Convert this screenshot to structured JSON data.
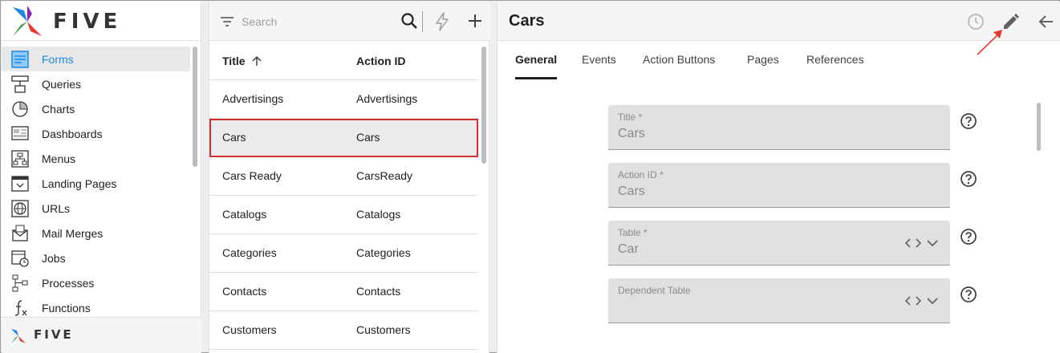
{
  "app": {
    "brand": "FIVE"
  },
  "sidebar": {
    "items": [
      {
        "label": "Forms",
        "icon": "forms-icon",
        "active": true
      },
      {
        "label": "Queries",
        "icon": "queries-icon"
      },
      {
        "label": "Charts",
        "icon": "charts-icon"
      },
      {
        "label": "Dashboards",
        "icon": "dashboards-icon"
      },
      {
        "label": "Menus",
        "icon": "menus-icon"
      },
      {
        "label": "Landing Pages",
        "icon": "landing-pages-icon"
      },
      {
        "label": "URLs",
        "icon": "urls-icon"
      },
      {
        "label": "Mail Merges",
        "icon": "mail-merges-icon"
      },
      {
        "label": "Jobs",
        "icon": "jobs-icon"
      },
      {
        "label": "Processes",
        "icon": "processes-icon"
      },
      {
        "label": "Functions",
        "icon": "functions-icon"
      }
    ]
  },
  "list": {
    "search_placeholder": "Search",
    "columns": {
      "title": "Title",
      "action_id": "Action ID"
    },
    "rows": [
      {
        "title": "Advertisings",
        "action_id": "Advertisings"
      },
      {
        "title": "Cars",
        "action_id": "Cars",
        "selected": true
      },
      {
        "title": "Cars Ready",
        "action_id": "CarsReady"
      },
      {
        "title": "Catalogs",
        "action_id": "Catalogs"
      },
      {
        "title": "Categories",
        "action_id": "Categories"
      },
      {
        "title": "Contacts",
        "action_id": "Contacts"
      },
      {
        "title": "Customers",
        "action_id": "Customers"
      }
    ]
  },
  "detail": {
    "title": "Cars",
    "tabs": [
      "General",
      "Events",
      "Action Buttons",
      "Pages",
      "References"
    ],
    "fields": [
      {
        "label": "Title *",
        "value": "Cars"
      },
      {
        "label": "Action ID *",
        "value": "Cars"
      },
      {
        "label": "Table *",
        "value": "Car"
      },
      {
        "label": "Dependent Table",
        "value": ""
      }
    ]
  },
  "colors": {
    "accent": "#1e88e5",
    "selection_outline": "#d32f2f",
    "annotation_arrow": "#e53935"
  }
}
